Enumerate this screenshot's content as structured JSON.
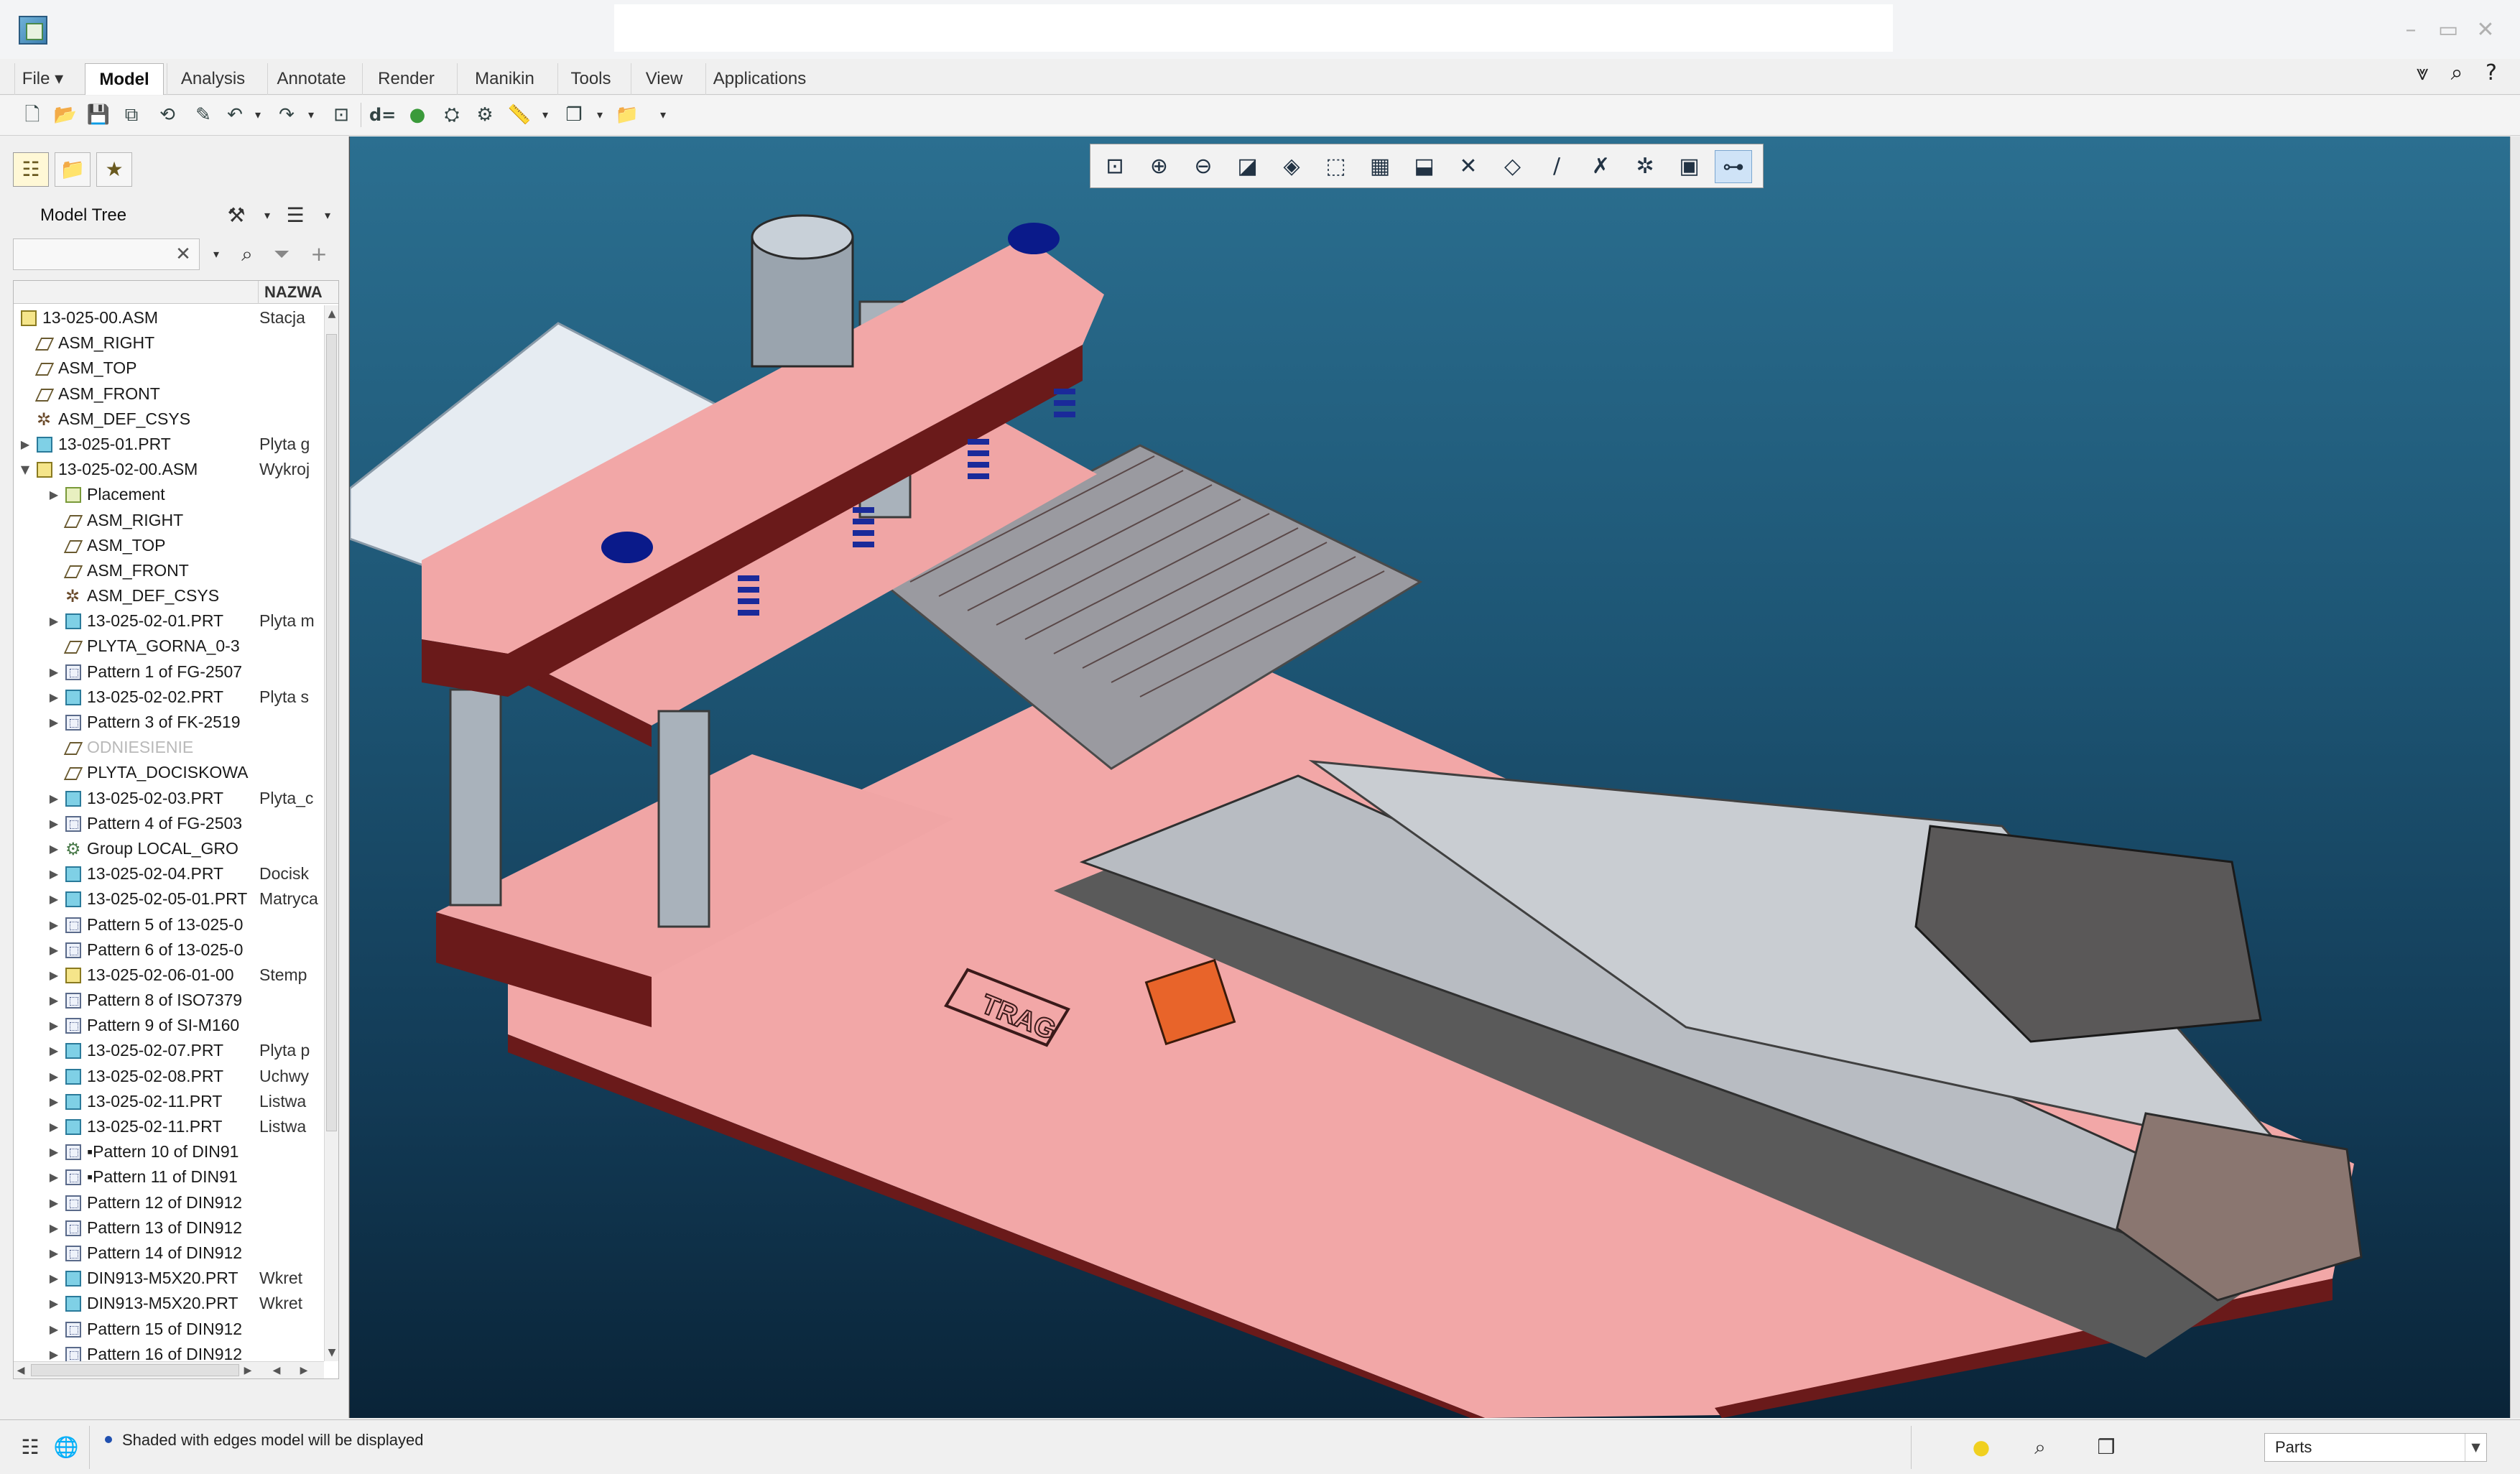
{
  "window": {
    "icons": {
      "app": "creo-app-icon",
      "minimize": "minimize-icon",
      "maximize": "maximize-icon",
      "close": "close-icon"
    }
  },
  "ribbon": {
    "tabs": [
      {
        "label": "File ▾",
        "active": false
      },
      {
        "label": "Model",
        "active": true
      },
      {
        "label": "Analysis",
        "active": false
      },
      {
        "label": "Annotate",
        "active": false
      },
      {
        "label": "Render",
        "active": false
      },
      {
        "label": "Manikin",
        "active": false
      },
      {
        "label": "Tools",
        "active": false
      },
      {
        "label": "View",
        "active": false
      },
      {
        "label": "Applications",
        "active": false
      }
    ],
    "right_icons": [
      "ribbon-collapse-icon",
      "search-icon",
      "help-icon"
    ]
  },
  "quick_toolbar": {
    "items": [
      "new-icon",
      "open-icon",
      "save-icon",
      "save-copy-icon",
      "regenerate-icon",
      "edit-icon",
      "undo-icon",
      "redo-icon",
      "zoom-fit-icon",
      "relations-icon",
      "appearance-icon",
      "render-icon",
      "regen-manager-icon",
      "measure-icon",
      "windows-icon",
      "open-folder-icon",
      "customize-icon"
    ],
    "relations_label": "d="
  },
  "left_panel": {
    "tabs": [
      "model-tree-tab-icon",
      "folder-browser-tab-icon",
      "favorites-tab-icon"
    ],
    "model_tree_label": "Model Tree",
    "search": {
      "value": "",
      "placeholder": ""
    },
    "column_header": "NAZWA",
    "rows": [
      {
        "name": "13-025-00.ASM",
        "desc": "Stacja",
        "depth": 0,
        "expand": "",
        "icon": "asm"
      },
      {
        "name": "ASM_RIGHT",
        "desc": "",
        "depth": 1,
        "expand": "",
        "icon": "plane"
      },
      {
        "name": "ASM_TOP",
        "desc": "",
        "depth": 1,
        "expand": "",
        "icon": "plane"
      },
      {
        "name": "ASM_FRONT",
        "desc": "",
        "depth": 1,
        "expand": "",
        "icon": "plane"
      },
      {
        "name": "ASM_DEF_CSYS",
        "desc": "",
        "depth": 1,
        "expand": "",
        "icon": "csys"
      },
      {
        "name": "13-025-01.PRT",
        "desc": "Plyta g",
        "depth": 1,
        "expand": "▶",
        "icon": "prt"
      },
      {
        "name": "13-025-02-00.ASM",
        "desc": "Wykroj",
        "depth": 1,
        "expand": "▼",
        "icon": "asm"
      },
      {
        "name": "Placement",
        "desc": "",
        "depth": 2,
        "expand": "▶",
        "icon": "place"
      },
      {
        "name": "ASM_RIGHT",
        "desc": "",
        "depth": 2,
        "expand": "",
        "icon": "plane"
      },
      {
        "name": "ASM_TOP",
        "desc": "",
        "depth": 2,
        "expand": "",
        "icon": "plane"
      },
      {
        "name": "ASM_FRONT",
        "desc": "",
        "depth": 2,
        "expand": "",
        "icon": "plane"
      },
      {
        "name": "ASM_DEF_CSYS",
        "desc": "",
        "depth": 2,
        "expand": "",
        "icon": "csys"
      },
      {
        "name": "13-025-02-01.PRT",
        "desc": "Plyta m",
        "depth": 2,
        "expand": "▶",
        "icon": "prt"
      },
      {
        "name": "PLYTA_GORNA_0-3",
        "desc": "",
        "depth": 2,
        "expand": "",
        "icon": "plane"
      },
      {
        "name": "Pattern 1 of FG-2507",
        "desc": "",
        "depth": 2,
        "expand": "▶",
        "icon": "pat"
      },
      {
        "name": "13-025-02-02.PRT",
        "desc": "Plyta s",
        "depth": 2,
        "expand": "▶",
        "icon": "prt"
      },
      {
        "name": "Pattern 3 of FK-2519",
        "desc": "",
        "depth": 2,
        "expand": "▶",
        "icon": "pat"
      },
      {
        "name": "ODNIESIENIE",
        "desc": "",
        "depth": 2,
        "expand": "",
        "icon": "plane",
        "dim": true
      },
      {
        "name": "PLYTA_DOCISKOWA",
        "desc": "",
        "depth": 2,
        "expand": "",
        "icon": "plane"
      },
      {
        "name": "13-025-02-03.PRT",
        "desc": "Plyta_c",
        "depth": 2,
        "expand": "▶",
        "icon": "prt"
      },
      {
        "name": "Pattern 4 of FG-2503",
        "desc": "",
        "depth": 2,
        "expand": "▶",
        "icon": "pat"
      },
      {
        "name": "Group LOCAL_GRO",
        "desc": "",
        "depth": 2,
        "expand": "▶",
        "icon": "grp"
      },
      {
        "name": "13-025-02-04.PRT",
        "desc": "Docisk",
        "depth": 2,
        "expand": "▶",
        "icon": "prt"
      },
      {
        "name": "13-025-02-05-01.PRT",
        "desc": "Matryca",
        "depth": 2,
        "expand": "▶",
        "icon": "prt"
      },
      {
        "name": "Pattern 5 of 13-025-0",
        "desc": "",
        "depth": 2,
        "expand": "▶",
        "icon": "pat"
      },
      {
        "name": "Pattern 6 of 13-025-0",
        "desc": "",
        "depth": 2,
        "expand": "▶",
        "icon": "pat"
      },
      {
        "name": "13-025-02-06-01-00",
        "desc": "Stemp",
        "depth": 2,
        "expand": "▶",
        "icon": "asm"
      },
      {
        "name": "Pattern 8 of ISO7379",
        "desc": "",
        "depth": 2,
        "expand": "▶",
        "icon": "pat"
      },
      {
        "name": "Pattern 9 of SI-M160",
        "desc": "",
        "depth": 2,
        "expand": "▶",
        "icon": "pat"
      },
      {
        "name": "13-025-02-07.PRT",
        "desc": "Plyta p",
        "depth": 2,
        "expand": "▶",
        "icon": "prt"
      },
      {
        "name": "13-025-02-08.PRT",
        "desc": "Uchwy",
        "depth": 2,
        "expand": "▶",
        "icon": "prt"
      },
      {
        "name": "13-025-02-11.PRT",
        "desc": "Listwa",
        "depth": 2,
        "expand": "▶",
        "icon": "prt"
      },
      {
        "name": "13-025-02-11.PRT",
        "desc": "Listwa",
        "depth": 2,
        "expand": "▶",
        "icon": "prt"
      },
      {
        "name": "▪Pattern 10 of DIN91",
        "desc": "",
        "depth": 2,
        "expand": "▶",
        "icon": "pat"
      },
      {
        "name": "▪Pattern 11 of DIN91",
        "desc": "",
        "depth": 2,
        "expand": "▶",
        "icon": "pat"
      },
      {
        "name": "Pattern 12 of DIN912",
        "desc": "",
        "depth": 2,
        "expand": "▶",
        "icon": "pat"
      },
      {
        "name": "Pattern 13 of DIN912",
        "desc": "",
        "depth": 2,
        "expand": "▶",
        "icon": "pat"
      },
      {
        "name": "Pattern 14 of DIN912",
        "desc": "",
        "depth": 2,
        "expand": "▶",
        "icon": "pat"
      },
      {
        "name": "DIN913-M5X20.PRT",
        "desc": "Wkret",
        "depth": 2,
        "expand": "▶",
        "icon": "prt"
      },
      {
        "name": "DIN913-M5X20.PRT",
        "desc": "Wkret",
        "depth": 2,
        "expand": "▶",
        "icon": "prt"
      },
      {
        "name": "Pattern 15 of DIN912",
        "desc": "",
        "depth": 2,
        "expand": "▶",
        "icon": "pat"
      },
      {
        "name": "Pattern 16 of DIN912",
        "desc": "",
        "depth": 2,
        "expand": "▶",
        "icon": "pat"
      }
    ]
  },
  "view_toolbar": {
    "items": [
      "refit-icon",
      "zoom-in-icon",
      "zoom-out-icon",
      "repaint-icon",
      "display-style-icon",
      "saved-orientations-icon",
      "view-manager-icon",
      "perspective-icon",
      "datum-display-icon",
      "plane-display-icon",
      "axis-display-icon",
      "point-display-icon",
      "csys-display-icon",
      "annotation-display-icon",
      "spin-center-icon"
    ]
  },
  "viewport": {
    "logo_text": "TRAG",
    "colors": {
      "bg_top": "#2b6f90",
      "bg_bottom": "#0a2438",
      "plate": "#f2a7a7",
      "plate_edge": "#6a1a1a"
    }
  },
  "status_bar": {
    "message": "Shaded with edges model will be displayed",
    "filter_value": "Parts",
    "icons": [
      "model-tree-toggle-icon",
      "browser-toggle-icon",
      "selection-lights-icon",
      "find-icon",
      "3d-box-icon"
    ]
  }
}
